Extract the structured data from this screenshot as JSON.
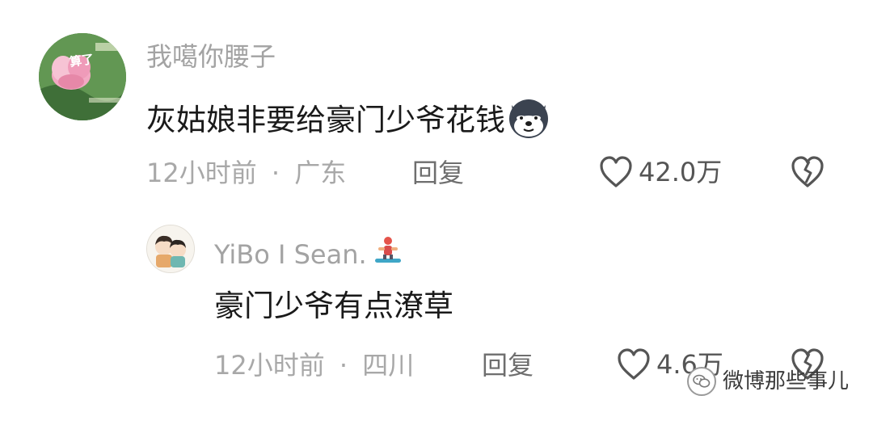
{
  "comment": {
    "username": "我噶你腰子",
    "text": "灰姑娘非要给豪门少爷花钱",
    "emoji": "dog-sticker",
    "time": "12小时前",
    "separator": "·",
    "location": "广东",
    "reply_label": "回复",
    "like_count": "42.0万",
    "avatar_text": "算了"
  },
  "reply": {
    "username": "YiBo I Sean.",
    "username_emoji": "snowboarder",
    "text": "豪门少爷有点潦草",
    "time": "12小时前",
    "separator": "·",
    "location": "四川",
    "reply_label": "回复",
    "like_count": "4.6万"
  },
  "watermark": {
    "text": "微博那些事儿"
  },
  "colors": {
    "text_primary": "#1a1a1a",
    "text_secondary": "#a3a3a3",
    "icon": "#555555"
  }
}
